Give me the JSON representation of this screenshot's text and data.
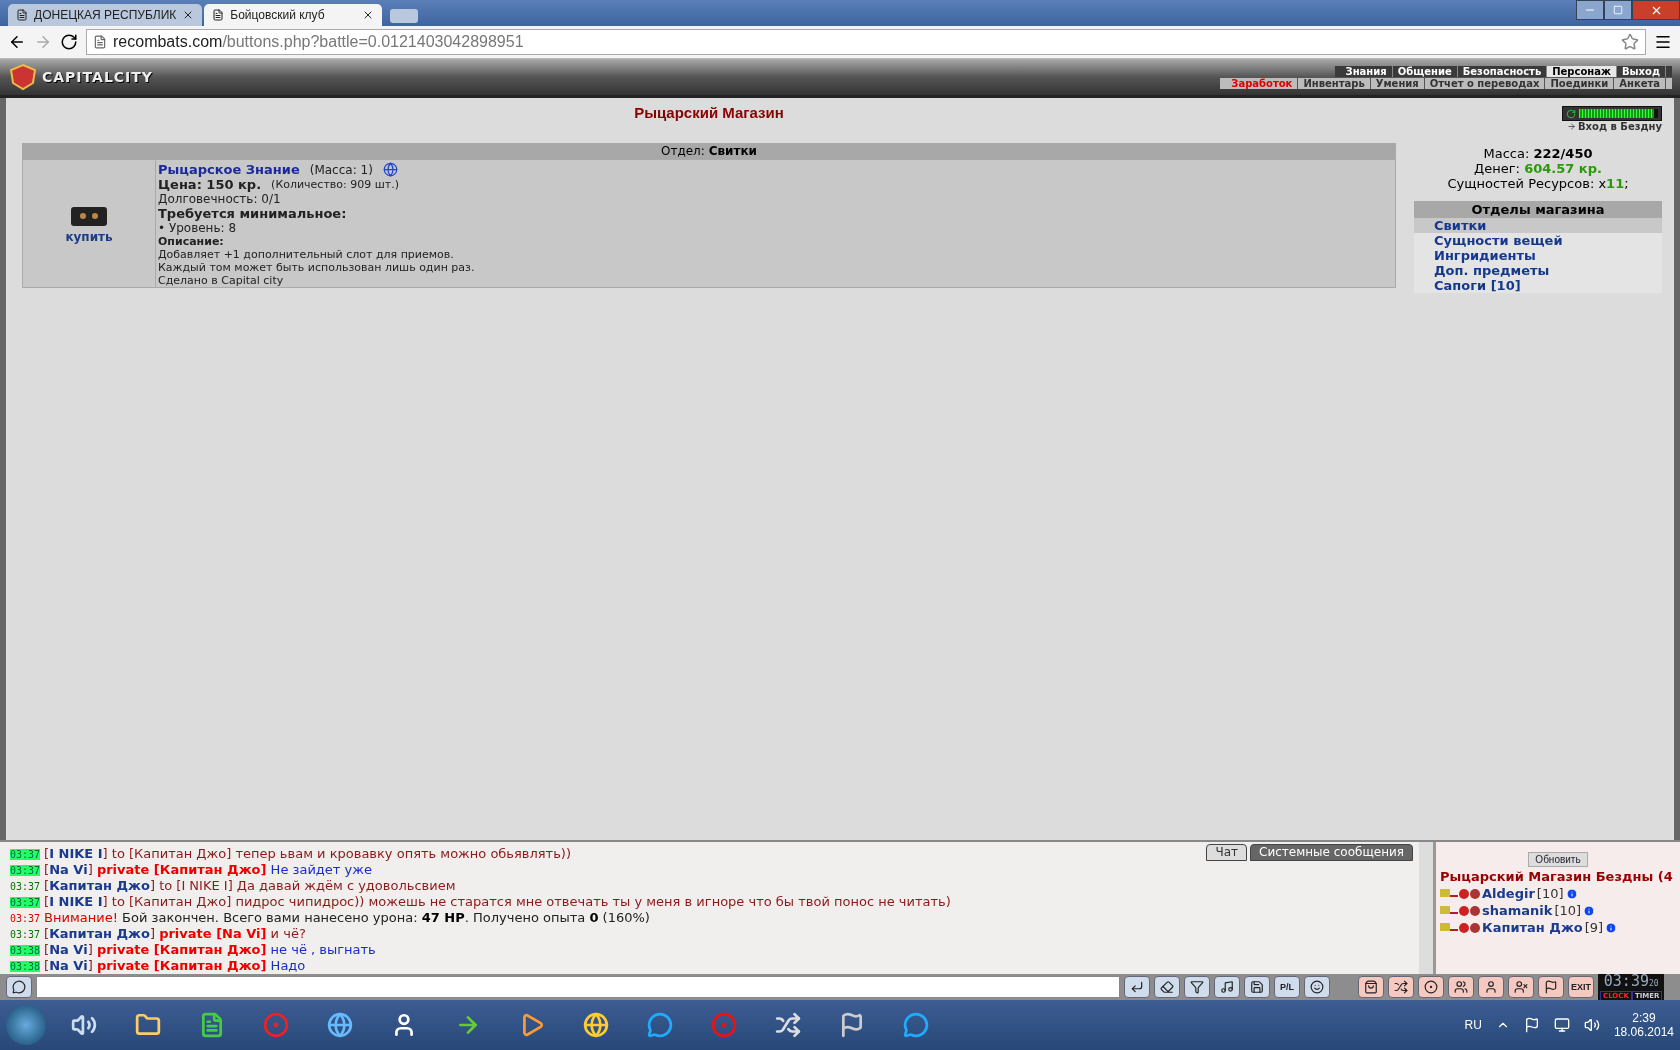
{
  "browser": {
    "tabs": [
      {
        "title": "ДОНЕЦКАЯ РЕСПУБЛИК",
        "selected": false
      },
      {
        "title": "Бойцовский клуб",
        "selected": true
      }
    ],
    "url_host": "recombats.com",
    "url_path": "/buttons.php?battle=0.0121403042898951"
  },
  "game_header": {
    "logo": "CAPITALCITY",
    "top_menu": [
      {
        "label": "Знания",
        "selected": false
      },
      {
        "label": "Общение",
        "selected": false
      },
      {
        "label": "Безопасность",
        "selected": false
      },
      {
        "label": "Персонаж",
        "selected": true
      },
      {
        "label": "Выход",
        "selected": false
      }
    ],
    "sub_menu": [
      {
        "label": "Заработок",
        "selected": true
      },
      {
        "label": "Инвентарь",
        "selected": false
      },
      {
        "label": "Умения",
        "selected": false
      },
      {
        "label": "Отчет о переводах",
        "selected": false
      },
      {
        "label": "Поединки",
        "selected": false
      },
      {
        "label": "Анкета",
        "selected": false
      }
    ]
  },
  "page_title": "Рыцарский Магазин",
  "department": {
    "label": "Отдел:",
    "value": "Свитки"
  },
  "item": {
    "buy": "купить",
    "name": "Рыцарское Знание",
    "mass": "(Масса: 1)",
    "price": "Цена: 150 кр.",
    "quantity": "(Количество: 909 шт.)",
    "durability": "Долговечность: 0/1",
    "requirements_title": "Требуется минимальное:",
    "requirements": [
      "• Уровень: 8"
    ],
    "description_title": "Описание:",
    "description": [
      "Добавляет +1 дополнительный слот для приемов.",
      "Каждый том может быть использован лишь один раз.",
      "Сделано в Capital city"
    ]
  },
  "abyss": {
    "level": 0.95,
    "link": "Вход в Бездну"
  },
  "stats": {
    "mass_label": "Масса:",
    "mass": "222/450",
    "money_label": "Денег:",
    "money": "604.57 кр.",
    "essence_label": "Сущностей Ресурсов: x",
    "essence": "11",
    "essence_end": ";"
  },
  "sections": {
    "title": "Отделы магазина",
    "items": [
      {
        "label": "Свитки",
        "selected": true
      },
      {
        "label": "Сущности вещей",
        "selected": false
      },
      {
        "label": "Ингридиенты",
        "selected": false
      },
      {
        "label": "Доп. предметы",
        "selected": false
      },
      {
        "label": "Сапоги [10]",
        "selected": false
      }
    ]
  },
  "chat": {
    "tabs": [
      {
        "label": "Чат",
        "selected": false
      },
      {
        "label": "Системные сообщения",
        "selected": true
      }
    ],
    "messages": [
      {
        "time": "03:37",
        "highlighted": true,
        "kind": "chat",
        "parts": [
          {
            "kind": "text",
            "text": "["
          },
          {
            "kind": "name",
            "text": "I NIKE I"
          },
          {
            "kind": "text",
            "text": "] to [Капитан Джо] тепер ьвам и кровавку опять можно обьявлять))"
          }
        ]
      },
      {
        "time": "03:37",
        "highlighted": true,
        "kind": "chat",
        "parts": [
          {
            "kind": "text",
            "text": "["
          },
          {
            "kind": "name",
            "text": "Na Vi"
          },
          {
            "kind": "text",
            "text": "] "
          },
          {
            "kind": "private",
            "text": "private [Капитан Джо]"
          },
          {
            "kind": "reply",
            "text": " Не зайдет уже"
          }
        ]
      },
      {
        "time": "03:37",
        "highlighted": false,
        "kind": "chat",
        "parts": [
          {
            "kind": "text",
            "text": "["
          },
          {
            "kind": "name",
            "text": "Капитан Джо"
          },
          {
            "kind": "text",
            "text": "] to [I NIKE I] Да давай ждём с удовольсвием"
          }
        ]
      },
      {
        "time": "03:37",
        "highlighted": true,
        "kind": "chat",
        "parts": [
          {
            "kind": "text",
            "text": "["
          },
          {
            "kind": "name",
            "text": "I NIKE I"
          },
          {
            "kind": "text",
            "text": "] to [Капитан Джо] пидрос чипидрос)) можешь не старатся мне отвечать ты у меня в игноре что бы твой понос не читать)"
          }
        ]
      },
      {
        "time": "03:37",
        "highlighted": false,
        "kind": "system",
        "parts": [
          {
            "kind": "alert",
            "text": "Внимание!"
          },
          {
            "kind": "plain",
            "text": " Бой закончен. Всего вами нанесено урона: "
          },
          {
            "kind": "strong",
            "text": "47 HP"
          },
          {
            "kind": "plain",
            "text": ". Получено опыта "
          },
          {
            "kind": "strong",
            "text": "0"
          },
          {
            "kind": "plain",
            "text": " (160%)"
          }
        ]
      },
      {
        "time": "03:37",
        "highlighted": false,
        "kind": "chat",
        "parts": [
          {
            "kind": "text",
            "text": "["
          },
          {
            "kind": "name",
            "text": "Капитан Джо"
          },
          {
            "kind": "text",
            "text": "] "
          },
          {
            "kind": "private",
            "text": "private [Na Vi]"
          },
          {
            "kind": "text",
            "text": " и чё?"
          }
        ]
      },
      {
        "time": "03:38",
        "highlighted": true,
        "kind": "chat",
        "parts": [
          {
            "kind": "text",
            "text": "["
          },
          {
            "kind": "name",
            "text": "Na Vi"
          },
          {
            "kind": "text",
            "text": "] "
          },
          {
            "kind": "private",
            "text": "private [Капитан Джо]"
          },
          {
            "kind": "reply",
            "text": " не чё , выгнать"
          }
        ]
      },
      {
        "time": "03:38",
        "highlighted": true,
        "kind": "chat",
        "parts": [
          {
            "kind": "text",
            "text": "["
          },
          {
            "kind": "name",
            "text": "Na Vi"
          },
          {
            "kind": "text",
            "text": "] "
          },
          {
            "kind": "private",
            "text": "private [Капитан Джо]"
          },
          {
            "kind": "reply",
            "text": " Надо"
          }
        ]
      }
    ]
  },
  "online": {
    "refresh": "Обновить",
    "room": "Рыцарский Магазин Бездны (4",
    "users": [
      {
        "name": "Aldegir",
        "level": "[10]"
      },
      {
        "name": "shamanik",
        "level": "[10]"
      },
      {
        "name": "Капитан Джо",
        "level": "[9]"
      }
    ]
  },
  "toolbar": {
    "pl": "P/L",
    "exit": "EXIT",
    "clock": "03:39",
    "seconds": "20",
    "clock_tab": "CLOCK",
    "timer_tab": "TIMER"
  },
  "taskbar": {
    "lang": "RU",
    "time": "2:39",
    "date": "18.06.2014"
  }
}
